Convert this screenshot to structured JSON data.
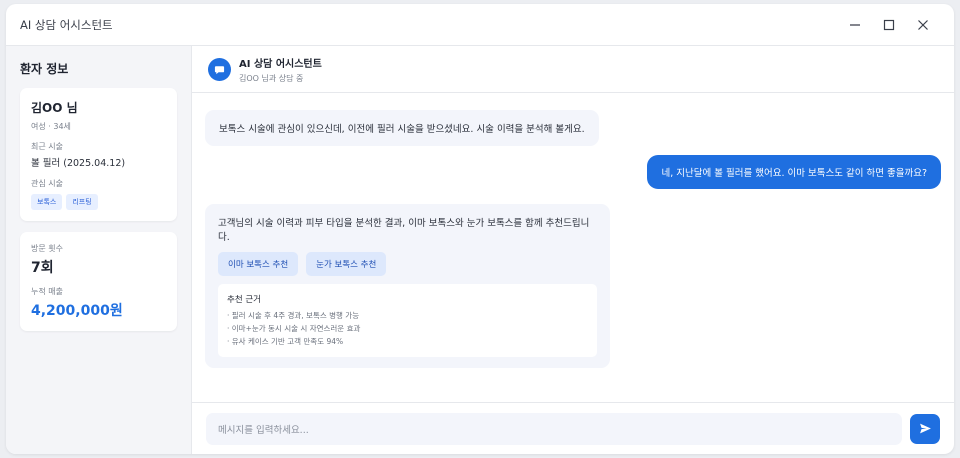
{
  "window": {
    "title": "AI 상담 어시스턴트"
  },
  "sidebar": {
    "heading": "환자 정보",
    "patient": {
      "name": "김OO 님",
      "meta": "여성 · 34세",
      "recent_label": "최근 시술",
      "recent_value": "볼 필러 (2025.04.12)",
      "interest_label": "관심 시술",
      "interests": [
        "보톡스",
        "리프팅"
      ]
    },
    "stats": {
      "visits_label": "방문 횟수",
      "visits_value": "7회",
      "sales_label": "누적 매출",
      "sales_value": "4,200,000원"
    }
  },
  "chat": {
    "header_title": "AI 상담 어시스턴트",
    "header_sub": "김OO 님과 상담 중",
    "messages": [
      {
        "role": "ai",
        "text": "보톡스 시술에 관심이 있으신데, 이전에 필러 시술을 받으셨네요. 시술 이력을 분석해 볼게요."
      },
      {
        "role": "user",
        "text": "네, 지난달에 볼 필러를 했어요. 이마 보톡스도 같이 하면 좋을까요?"
      },
      {
        "role": "ai",
        "text": "고객님의 시술 이력과 피부 타입을 분석한 결과, 이마 보톡스와 눈가 보톡스를 함께 추천드립니다.",
        "chips": [
          "이마 보톡스 추천",
          "눈가 보톡스 추천"
        ],
        "reason_title": "추천 근거",
        "reasons": [
          "· 필러 시술 후 4주 경과, 보톡스 병행 가능",
          "· 이마+눈가 동시 시술 시 자연스러운 효과",
          "· 유사 케이스 기반 고객 만족도 94%"
        ]
      }
    ],
    "input_placeholder": "메시지를 입력하세요..."
  },
  "colors": {
    "accent": "#1f6fe0",
    "ai_bubble": "#f3f5fb",
    "tag_bg": "#e7efff"
  },
  "icons": {
    "avatar": "chat-bubble-icon",
    "send": "send-icon",
    "minimize": "minimize-icon",
    "maximize": "maximize-icon",
    "close": "close-icon"
  }
}
